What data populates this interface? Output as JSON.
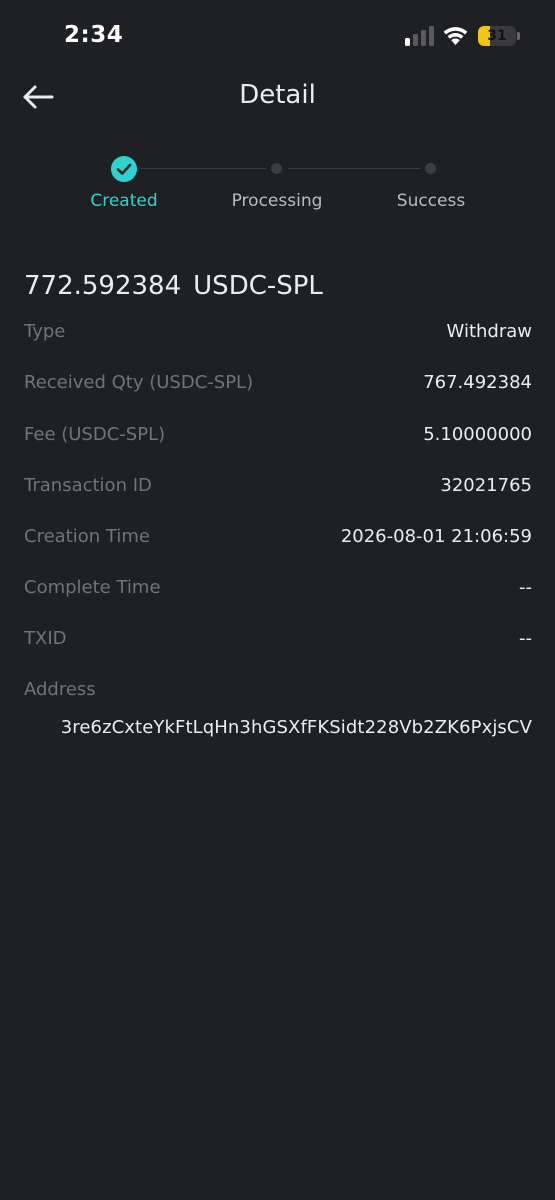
{
  "status_bar": {
    "time": "2:34",
    "battery_level": "31",
    "battery_fraction": 0.31,
    "signal_bars_active": 1,
    "signal_bars_total": 4
  },
  "header": {
    "title": "Detail",
    "back_icon": "arrow-left-icon"
  },
  "stepper": {
    "steps": [
      {
        "label": "Created",
        "state": "completed"
      },
      {
        "label": "Processing",
        "state": "pending"
      },
      {
        "label": "Success",
        "state": "pending"
      }
    ],
    "accent_color": "#2ed3d0"
  },
  "amount": {
    "value": "772.592384",
    "currency": "USDC-SPL"
  },
  "details": [
    {
      "label": "Type",
      "value": "Withdraw"
    },
    {
      "label": "Received Qty (USDC-SPL)",
      "value": "767.492384"
    },
    {
      "label": "Fee (USDC-SPL)",
      "value": "5.10000000"
    },
    {
      "label": "Transaction ID",
      "value": "32021765"
    },
    {
      "label": "Creation Time",
      "value": "2026-08-01 21:06:59"
    },
    {
      "label": "Complete Time",
      "value": "--"
    },
    {
      "label": "TXID",
      "value": "--"
    }
  ],
  "address": {
    "label": "Address",
    "value": "3re6zCxteYkFtLqHn3hGSXfFKSidt228Vb2ZK6PxjsCV"
  },
  "colors": {
    "background": "#1e2023",
    "label_text": "#6f747c",
    "value_text": "#eaecef",
    "battery_fill": "#f2c511"
  }
}
